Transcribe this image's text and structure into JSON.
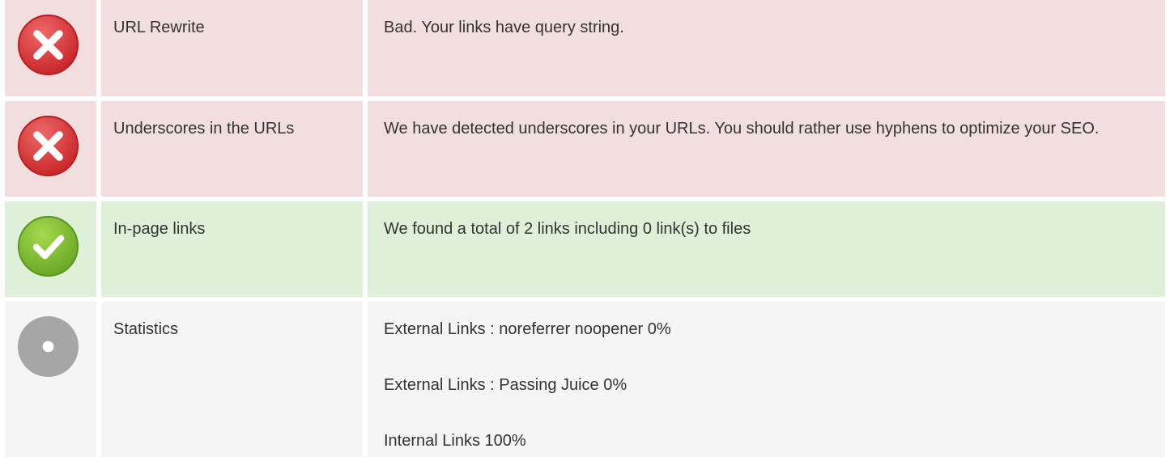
{
  "rows": [
    {
      "status": "bad",
      "icon": "error-icon",
      "name": "URL Rewrite",
      "description": "Bad. Your links have query string."
    },
    {
      "status": "bad",
      "icon": "error-icon",
      "name": "Underscores in the URLs",
      "description": "We have detected underscores in your URLs. You should rather use hyphens to optimize your SEO."
    },
    {
      "status": "good",
      "icon": "check-icon",
      "name": "In-page links",
      "description": "We found a total of 2 links including 0 link(s) to files"
    },
    {
      "status": "info",
      "icon": "info-dot-icon",
      "name": "Statistics",
      "stats": [
        "External Links : noreferrer noopener 0%",
        "External Links : Passing Juice 0%",
        "Internal Links 100%"
      ]
    }
  ],
  "colors": {
    "bad_bg": "#f2dedf",
    "good_bg": "#dff0d8",
    "info_bg": "#f5f5f5",
    "error_red": "#d9383b",
    "success_green": "#7cba2e",
    "neutral_gray": "#a6a6a6"
  }
}
